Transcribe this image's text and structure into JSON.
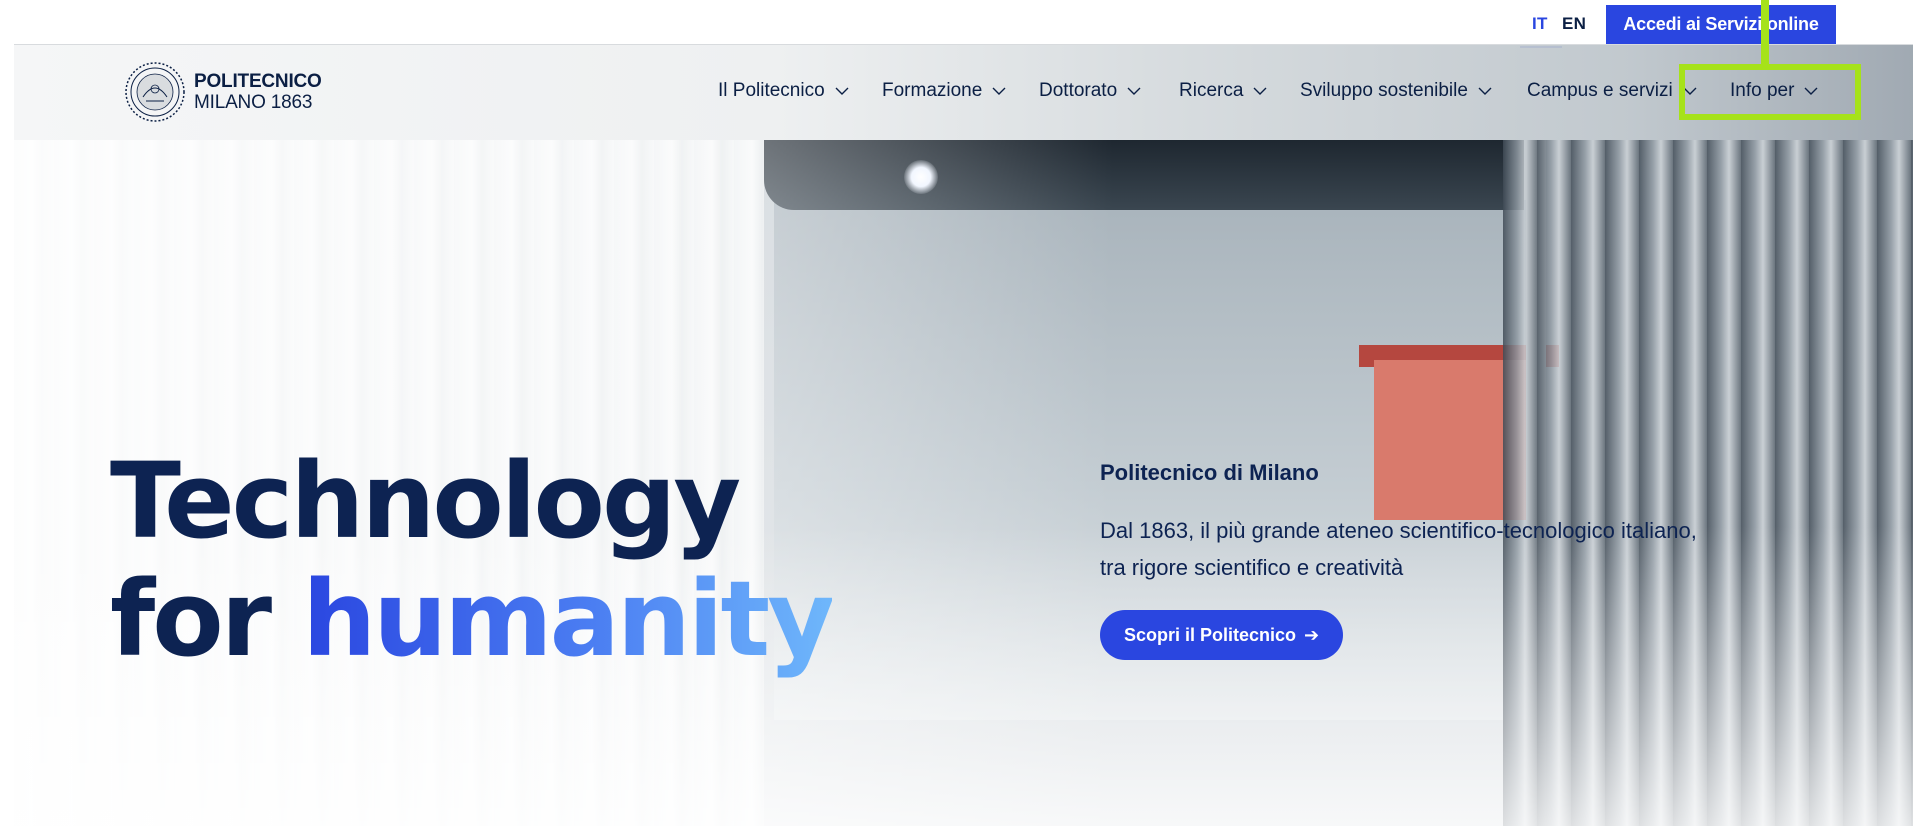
{
  "utility": {
    "languages": [
      {
        "code": "IT",
        "active": true
      },
      {
        "code": "EN",
        "active": false
      }
    ],
    "login_label": "Accedi ai Servizi online"
  },
  "header": {
    "logo": {
      "name": "POLITECNICO",
      "subtitle": "MILANO 1863"
    },
    "nav": [
      {
        "label": "Il Politecnico"
      },
      {
        "label": "Formazione"
      },
      {
        "label": "Dottorato"
      },
      {
        "label": "Ricerca"
      },
      {
        "label": "Sviluppo sostenibile"
      },
      {
        "label": "Campus e servizi"
      },
      {
        "label": "Info per"
      }
    ]
  },
  "hero": {
    "title_line1": "Technology",
    "title_line2_prefix": "for ",
    "title_line2_accent": "humanity",
    "kicker": "Politecnico di Milano",
    "description": "Dal 1863, il più grande ateneo scientifico-tecnologico italiano, tra rigore scientifico e creatività",
    "cta_label": "Scopri il Politecnico",
    "cta_icon": "arrow-right-icon"
  },
  "colors": {
    "brand_blue": "#2a46e0",
    "navy": "#0d2352",
    "highlight": "#a6e21a"
  }
}
